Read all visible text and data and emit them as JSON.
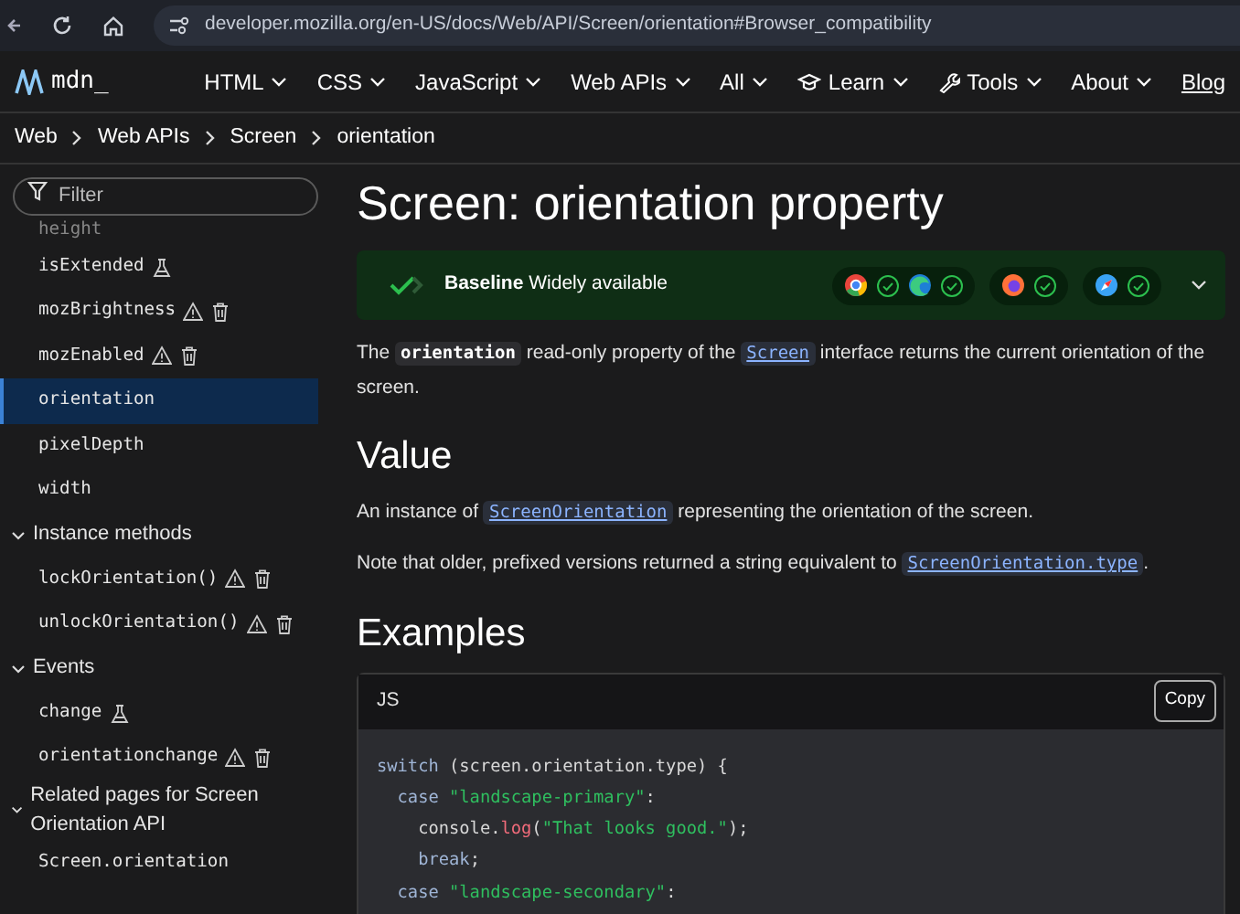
{
  "browser": {
    "url": "developer.mozilla.org/en-US/docs/Web/API/Screen/orientation#Browser_compatibility"
  },
  "logo": {
    "text": "mdn_"
  },
  "nav": [
    {
      "label": "HTML",
      "kind": "menu"
    },
    {
      "label": "CSS",
      "kind": "menu"
    },
    {
      "label": "JavaScript",
      "kind": "menu"
    },
    {
      "label": "Web APIs",
      "kind": "menu"
    },
    {
      "label": "All",
      "kind": "menu"
    },
    {
      "label": "Learn",
      "kind": "learn"
    },
    {
      "label": "Tools",
      "kind": "tools"
    },
    {
      "label": "About",
      "kind": "menu"
    },
    {
      "label": "Blog",
      "kind": "link"
    }
  ],
  "breadcrumbs": [
    "Web",
    "Web APIs",
    "Screen",
    "orientation"
  ],
  "sidebar": {
    "filter": {
      "placeholder": "Filter"
    },
    "items": [
      {
        "kind": "faded",
        "label": "height",
        "selected": false,
        "experimental": false,
        "deprecated": false,
        "non_standard": false
      },
      {
        "kind": "item",
        "label": "isExtended",
        "selected": false,
        "experimental": true,
        "deprecated": false,
        "non_standard": false
      },
      {
        "kind": "item",
        "label": "mozBrightness",
        "selected": false,
        "experimental": false,
        "deprecated": true,
        "non_standard": true
      },
      {
        "kind": "item",
        "label": "mozEnabled",
        "selected": false,
        "experimental": false,
        "deprecated": true,
        "non_standard": true
      },
      {
        "kind": "item",
        "label": "orientation",
        "selected": true,
        "experimental": false,
        "deprecated": false,
        "non_standard": false
      },
      {
        "kind": "item",
        "label": "pixelDepth",
        "selected": false,
        "experimental": false,
        "deprecated": false,
        "non_standard": false
      },
      {
        "kind": "item",
        "label": "width",
        "selected": false,
        "experimental": false,
        "deprecated": false,
        "non_standard": false
      },
      {
        "kind": "section",
        "label": "Instance methods",
        "expanded": true
      },
      {
        "kind": "item",
        "label": "lockOrientation()",
        "selected": false,
        "experimental": false,
        "deprecated": true,
        "non_standard": true
      },
      {
        "kind": "item",
        "label": "unlockOrientation()",
        "selected": false,
        "experimental": false,
        "deprecated": true,
        "non_standard": true
      },
      {
        "kind": "section",
        "label": "Events",
        "expanded": true
      },
      {
        "kind": "item",
        "label": "change",
        "selected": false,
        "experimental": true,
        "deprecated": false,
        "non_standard": false
      },
      {
        "kind": "item",
        "label": "orientationchange",
        "selected": false,
        "experimental": false,
        "deprecated": true,
        "non_standard": true
      },
      {
        "kind": "section",
        "label": "Related pages for Screen Orientation API",
        "expanded": true
      },
      {
        "kind": "item",
        "label": "Screen.orientation",
        "selected": false,
        "experimental": false,
        "deprecated": false,
        "non_standard": false
      }
    ]
  },
  "article": {
    "title": "Screen: orientation property",
    "baseline": {
      "text": "**Baseline** Widely available"
    },
    "blocks": [
      {
        "kind": "p",
        "parts": [
          {
            "kind": "text",
            "text": "The "
          },
          {
            "kind": "code",
            "text": "orientation"
          },
          {
            "kind": "text",
            "text": " read-only property of the "
          },
          {
            "kind": "link",
            "text": "Screen"
          },
          {
            "kind": "text",
            "text": " interface returns the current orientation of the screen."
          }
        ]
      },
      {
        "kind": "h2",
        "text": "Value"
      },
      {
        "kind": "p",
        "parts": [
          {
            "kind": "text",
            "text": "An instance of "
          },
          {
            "kind": "link",
            "text": "ScreenOrientation"
          },
          {
            "kind": "text",
            "text": " representing the orientation of the screen."
          }
        ]
      },
      {
        "kind": "p",
        "parts": [
          {
            "kind": "text",
            "text": "Note that older, prefixed versions returned a string equivalent to "
          },
          {
            "kind": "link",
            "text": "ScreenOrientation.type"
          },
          {
            "kind": "text",
            "text": "."
          }
        ]
      },
      {
        "kind": "h2",
        "text": "Examples"
      }
    ],
    "code": {
      "language": "JS",
      "copy": "Copy",
      "lines": [
        [
          {
            "kind": "kw",
            "text": "switch"
          },
          {
            "kind": "plain",
            "text": " (screen.orientation.type) {"
          }
        ],
        [
          {
            "kind": "kw",
            "text": "  case"
          },
          {
            "kind": "str",
            "text": " \"landscape-primary\""
          },
          {
            "kind": "plain",
            "text": ":"
          }
        ],
        [
          {
            "kind": "plain",
            "text": "    console."
          },
          {
            "kind": "fn",
            "text": "log"
          },
          {
            "kind": "plain",
            "text": "("
          },
          {
            "kind": "str",
            "text": "\"That looks good.\""
          },
          {
            "kind": "plain",
            "text": ");"
          }
        ],
        [
          {
            "kind": "kw",
            "text": "    break"
          },
          {
            "kind": "plain",
            "text": ";"
          }
        ],
        [
          {
            "kind": "kw",
            "text": "  case"
          },
          {
            "kind": "str",
            "text": " \"landscape-secondary\""
          },
          {
            "kind": "plain",
            "text": ":"
          }
        ]
      ]
    }
  }
}
